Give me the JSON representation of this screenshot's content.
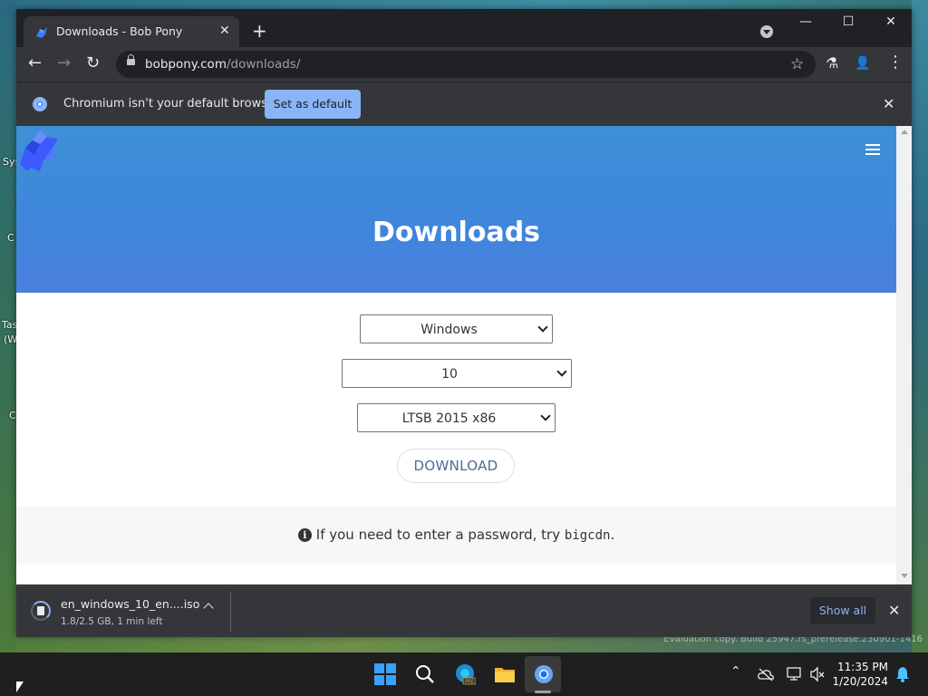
{
  "desktop": {
    "labels": [
      "Sys",
      "C",
      "Tas",
      "(W",
      "C"
    ],
    "watermark": "Evaluation copy. Build 25947.rs_prerelease.230901-1416"
  },
  "browser": {
    "tab": {
      "title": "Downloads - Bob Pony",
      "close": "✕"
    },
    "new_tab": "+",
    "window_controls": {
      "minimize": "—",
      "maximize": "☐",
      "close": "✕"
    },
    "toolbar": {
      "back": "←",
      "forward": "→",
      "reload": "↻",
      "url_host": "bobpony.com",
      "url_path": "/downloads/",
      "star": "☆",
      "labs": "⚗",
      "profile": "👤",
      "menu": "⋮"
    },
    "infobar": {
      "message": "Chromium isn't your default browser",
      "button": "Set as default",
      "close": "✕"
    }
  },
  "page": {
    "title": "Downloads",
    "selects": {
      "os": {
        "value": "Windows"
      },
      "version": {
        "value": "10"
      },
      "edition": {
        "value": "LTSB 2015 x86"
      }
    },
    "download_button": "DOWNLOAD",
    "note": {
      "icon": "i",
      "prefix": "If you need to enter a password, try ",
      "code": "bigcdn",
      "suffix": "."
    }
  },
  "download_shelf": {
    "file_name": "en_windows_10_en....iso",
    "status": "1.8/2.5 GB, 1 min left",
    "progress_fraction": 0.72,
    "show_all": "Show all",
    "close": "✕"
  },
  "taskbar": {
    "time": "11:35 PM",
    "date": "1/20/2024",
    "tray_up": "⌃"
  },
  "colors": {
    "hero_start": "#3d90d6",
    "hero_end": "#4b7fde",
    "accent": "#8ab4f8",
    "chrome_dark": "#202124",
    "chrome_toolbar": "#35363a"
  }
}
